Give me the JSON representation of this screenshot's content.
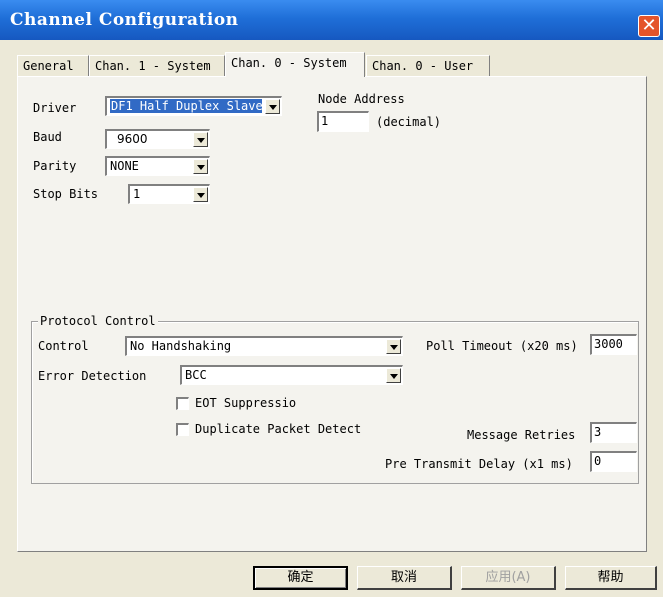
{
  "window": {
    "title": "Channel Configuration",
    "close_glyph": "✕"
  },
  "tabs": [
    {
      "label": "General"
    },
    {
      "label": "Chan. 1 - System"
    },
    {
      "label": "Chan. 0 - System"
    },
    {
      "label": "Chan. 0 - User"
    }
  ],
  "active_tab": 2,
  "system": {
    "driver": {
      "label": "Driver",
      "value": "DF1 Half Duplex Slave"
    },
    "baud": {
      "label": "Baud",
      "value": "9600"
    },
    "parity": {
      "label": "Parity",
      "value": "NONE"
    },
    "stop_bits": {
      "label": "Stop Bits",
      "value": "1"
    },
    "node_address": {
      "label": "Node Address",
      "value": "1",
      "unit": "(decimal)"
    }
  },
  "protocol": {
    "group_title": "Protocol Control",
    "control": {
      "label": "Control",
      "value": "No Handshaking"
    },
    "error_detection": {
      "label": "Error Detection",
      "value": "BCC"
    },
    "eot_suppression": {
      "label": "EOT Suppressio",
      "checked": false
    },
    "duplicate_packet": {
      "label": "Duplicate Packet Detect",
      "checked": false
    },
    "poll_timeout": {
      "label": "Poll Timeout (x20 ms)",
      "value": "3000"
    },
    "message_retries": {
      "label": "Message Retries",
      "value": "3"
    },
    "pre_transmit_delay": {
      "label": "Pre Transmit Delay (x1 ms)",
      "value": "0"
    }
  },
  "buttons": {
    "ok": "确定",
    "cancel": "取消",
    "apply": "应用(A)",
    "help": "帮助"
  },
  "colors": {
    "titlebar": "#1f6fd8",
    "selection": "#316ac5",
    "close": "#e4542a"
  }
}
